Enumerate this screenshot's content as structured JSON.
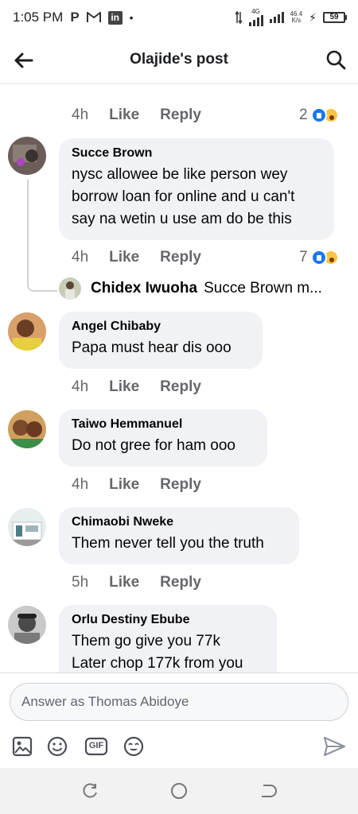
{
  "status_bar": {
    "time": "1:05 PM",
    "icons": [
      "parking-icon",
      "gmail-icon",
      "linkedin-icon",
      "dot-icon"
    ],
    "network": "4G",
    "speed_value": "46.4",
    "speed_unit": "K/s",
    "battery": "59"
  },
  "header": {
    "title": "Olajide's post",
    "back_icon": "arrow-left-icon",
    "search_icon": "search-icon"
  },
  "top_meta": {
    "time": "4h",
    "like": "Like",
    "reply": "Reply",
    "reactions": "2"
  },
  "comments": [
    {
      "author": "Succe Brown",
      "text": [
        "nysc allowee be like person wey",
        "borrow loan for online and u can't",
        "say na wetin u use am do be this"
      ],
      "time": "4h",
      "like": "Like",
      "reply": "Reply",
      "reactions": "7"
    },
    {
      "author": "Angel Chibaby",
      "text": [
        "Papa must hear dis ooo"
      ],
      "time": "4h",
      "like": "Like",
      "reply": "Reply"
    },
    {
      "author": "Taiwo Hemmanuel",
      "text": [
        "Do not gree for ham ooo"
      ],
      "time": "4h",
      "like": "Like",
      "reply": "Reply"
    },
    {
      "author": "Chimaobi Nweke",
      "text": [
        "Them never tell you the truth"
      ],
      "time": "5h",
      "like": "Like",
      "reply": "Reply"
    },
    {
      "author": "Orlu Destiny Ebube",
      "text": [
        "Them go give you 77k",
        "Later chop 177k from you"
      ]
    }
  ],
  "reply_preview": {
    "author": "Chidex Iwuoha",
    "text": "Succe Brown m..."
  },
  "composer": {
    "placeholder": "Answer as Thomas Abidoye",
    "tools": [
      "photo-icon",
      "emoji-icon",
      "gif-icon",
      "sticker-icon"
    ],
    "gif_label": "GIF",
    "send_icon": "send-icon"
  },
  "nav": [
    "recents-icon",
    "home-icon",
    "back-icon"
  ],
  "colors": {
    "accent": "#1877f2",
    "bubble": "#f0f2f5",
    "muted": "#65676b"
  }
}
